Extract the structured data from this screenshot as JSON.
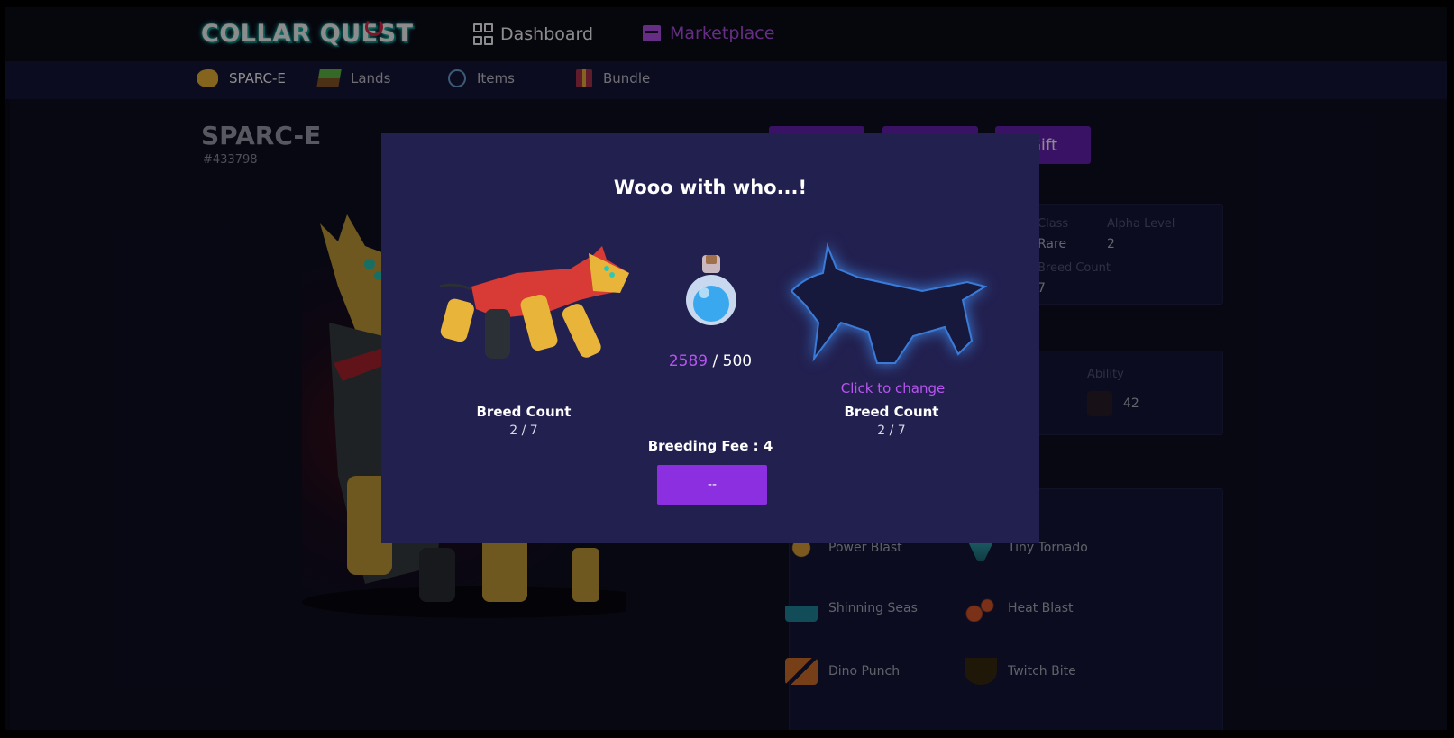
{
  "app": {
    "logo": "COLLAR QUEST"
  },
  "nav": {
    "dashboard": "Dashboard",
    "marketplace": "Marketplace"
  },
  "subnav": [
    {
      "label": "SPARC-E",
      "icon": "mouse-icon"
    },
    {
      "label": "Lands",
      "icon": "land-icon"
    },
    {
      "label": "Items",
      "icon": "items-icon"
    },
    {
      "label": "Bundle",
      "icon": "gift-icon"
    }
  ],
  "dog": {
    "name": "SPARC-E",
    "id": "#433798"
  },
  "actions": {
    "gift": "Gift"
  },
  "stats": {
    "class_label": "Class",
    "class_value": "Rare",
    "alpha_label": "Alpha Level",
    "alpha_value": "2",
    "breed_label": "Breed Count",
    "breed_value": "7",
    "ability_label": "Ability",
    "ability_value": "42"
  },
  "skills": [
    {
      "name": "Power Blast",
      "icon": "demon-face-icon"
    },
    {
      "name": "Tiny Tornado",
      "icon": "tornado-icon"
    },
    {
      "name": "Shinning Seas",
      "icon": "wave-icon"
    },
    {
      "name": "Heat Blast",
      "icon": "meteor-icon"
    },
    {
      "name": "Dino Punch",
      "icon": "wings-icon"
    },
    {
      "name": "Twitch Bite",
      "icon": "jaw-icon"
    }
  ],
  "modal": {
    "title": "Wooo with who...!",
    "potion_current": "2589",
    "potion_total": "/ 500",
    "click_to_change": "Click to change",
    "left_breed_label": "Breed Count",
    "left_breed_value": "2 / 7",
    "right_breed_label": "Breed Count",
    "right_breed_value": "2 / 7",
    "fee": "Breeding Fee : 4",
    "breed_button": "--"
  },
  "colors": {
    "accent": "#b855f0",
    "button": "#8b2fe0",
    "modal_bg": "#22204f"
  }
}
